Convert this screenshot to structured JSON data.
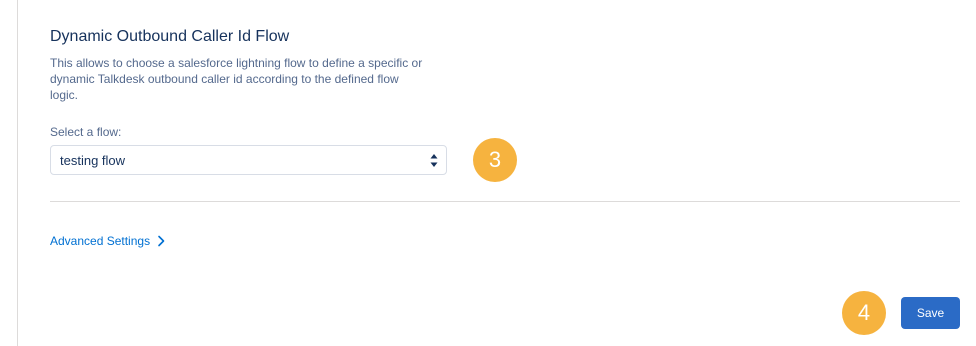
{
  "section": {
    "title": "Dynamic Outbound Caller Id Flow",
    "description_lines": [
      "This allows to choose a salesforce lightning flow to define a specific or",
      "dynamic Talkdesk outbound caller id according to the defined flow",
      "logic."
    ]
  },
  "flow_select": {
    "label": "Select a flow:",
    "selected_value": "testing flow"
  },
  "advanced_settings": {
    "label": "Advanced Settings"
  },
  "actions": {
    "save_label": "Save"
  },
  "annotations": {
    "step_3": "3",
    "step_4": "4"
  },
  "colors": {
    "link": "#0070d2",
    "primary_button": "#2b6bc6",
    "badge": "#f6b33f",
    "title_text": "#16325c",
    "muted_text": "#54698d"
  },
  "icons": {
    "select_arrows": "up-down-arrows-icon",
    "advanced_chevron": "chevron-right-icon"
  }
}
